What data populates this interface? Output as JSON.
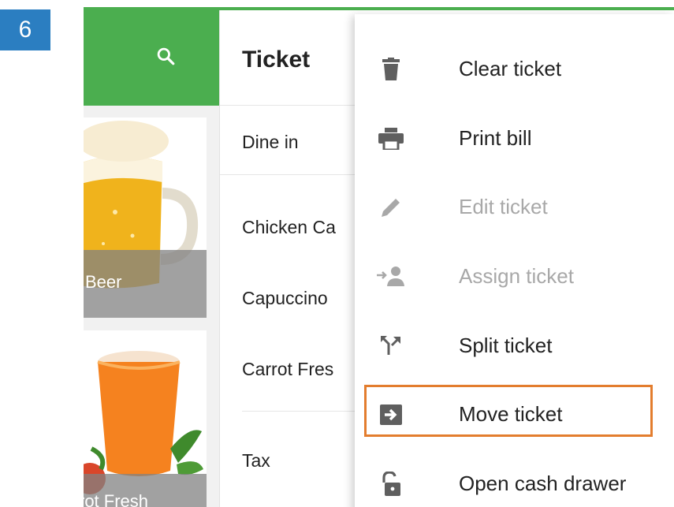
{
  "step_badge": "6",
  "left_panel": {
    "items": [
      {
        "label": "Beer"
      },
      {
        "label": "rot Fresh"
      }
    ]
  },
  "ticket": {
    "title": "Ticket",
    "dine_option": "Dine in",
    "lines": [
      "Chicken Ca",
      "Capuccino",
      "Carrot Fres"
    ],
    "tax_label": "Tax"
  },
  "menu": {
    "items": [
      {
        "label": "Clear ticket",
        "icon": "trash-icon",
        "enabled": true
      },
      {
        "label": "Print bill",
        "icon": "printer-icon",
        "enabled": true
      },
      {
        "label": "Edit ticket",
        "icon": "pencil-icon",
        "enabled": false
      },
      {
        "label": "Assign ticket",
        "icon": "assign-user-icon",
        "enabled": false
      },
      {
        "label": "Split ticket",
        "icon": "split-icon",
        "enabled": true
      },
      {
        "label": "Move ticket",
        "icon": "move-arrow-icon",
        "enabled": true,
        "highlighted": true
      },
      {
        "label": "Open cash drawer",
        "icon": "unlock-icon",
        "enabled": true
      }
    ]
  },
  "colors": {
    "accent_green": "#4bae4f",
    "badge_blue": "#2b7ec1",
    "highlight_orange": "#e37d2e"
  }
}
